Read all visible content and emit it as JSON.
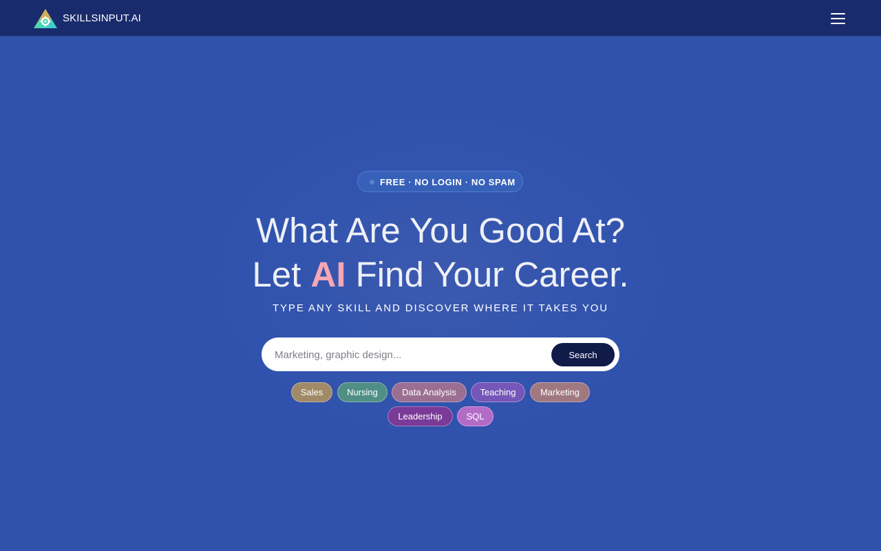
{
  "header": {
    "brand": "SKILLSINPUT.AI",
    "logo_icon": "triangle-gear-logo",
    "menu_icon": "hamburger-menu-icon"
  },
  "hero": {
    "badge": "FREE · NO LOGIN · NO SPAM",
    "headline_line1": "What Are You Good At?",
    "headline_line2_before": "Let",
    "headline_line2_highlight": "AI",
    "headline_line2_after": "Find Your Career.",
    "subline": "TYPE ANY SKILL AND DISCOVER WHERE IT TAKES YOU"
  },
  "search": {
    "placeholder": "Marketing, graphic design...",
    "value": "",
    "button_label": "Search"
  },
  "chips": [
    {
      "label": "Sales",
      "color": "#a08a68"
    },
    {
      "label": "Nursing",
      "color": "#4f8f86"
    },
    {
      "label": "Data Analysis",
      "color": "#9b6f92"
    },
    {
      "label": "Teaching",
      "color": "#7656b8"
    },
    {
      "label": "Marketing",
      "color": "#a07880"
    },
    {
      "label": "Leadership",
      "color": "#7a3a98"
    },
    {
      "label": "SQL",
      "color": "#b26cc8"
    }
  ],
  "colors": {
    "background": "#2f52ad",
    "header": "#1a2b6d",
    "accent_ai": "#f5a7b5",
    "search_button": "#111b4a"
  }
}
